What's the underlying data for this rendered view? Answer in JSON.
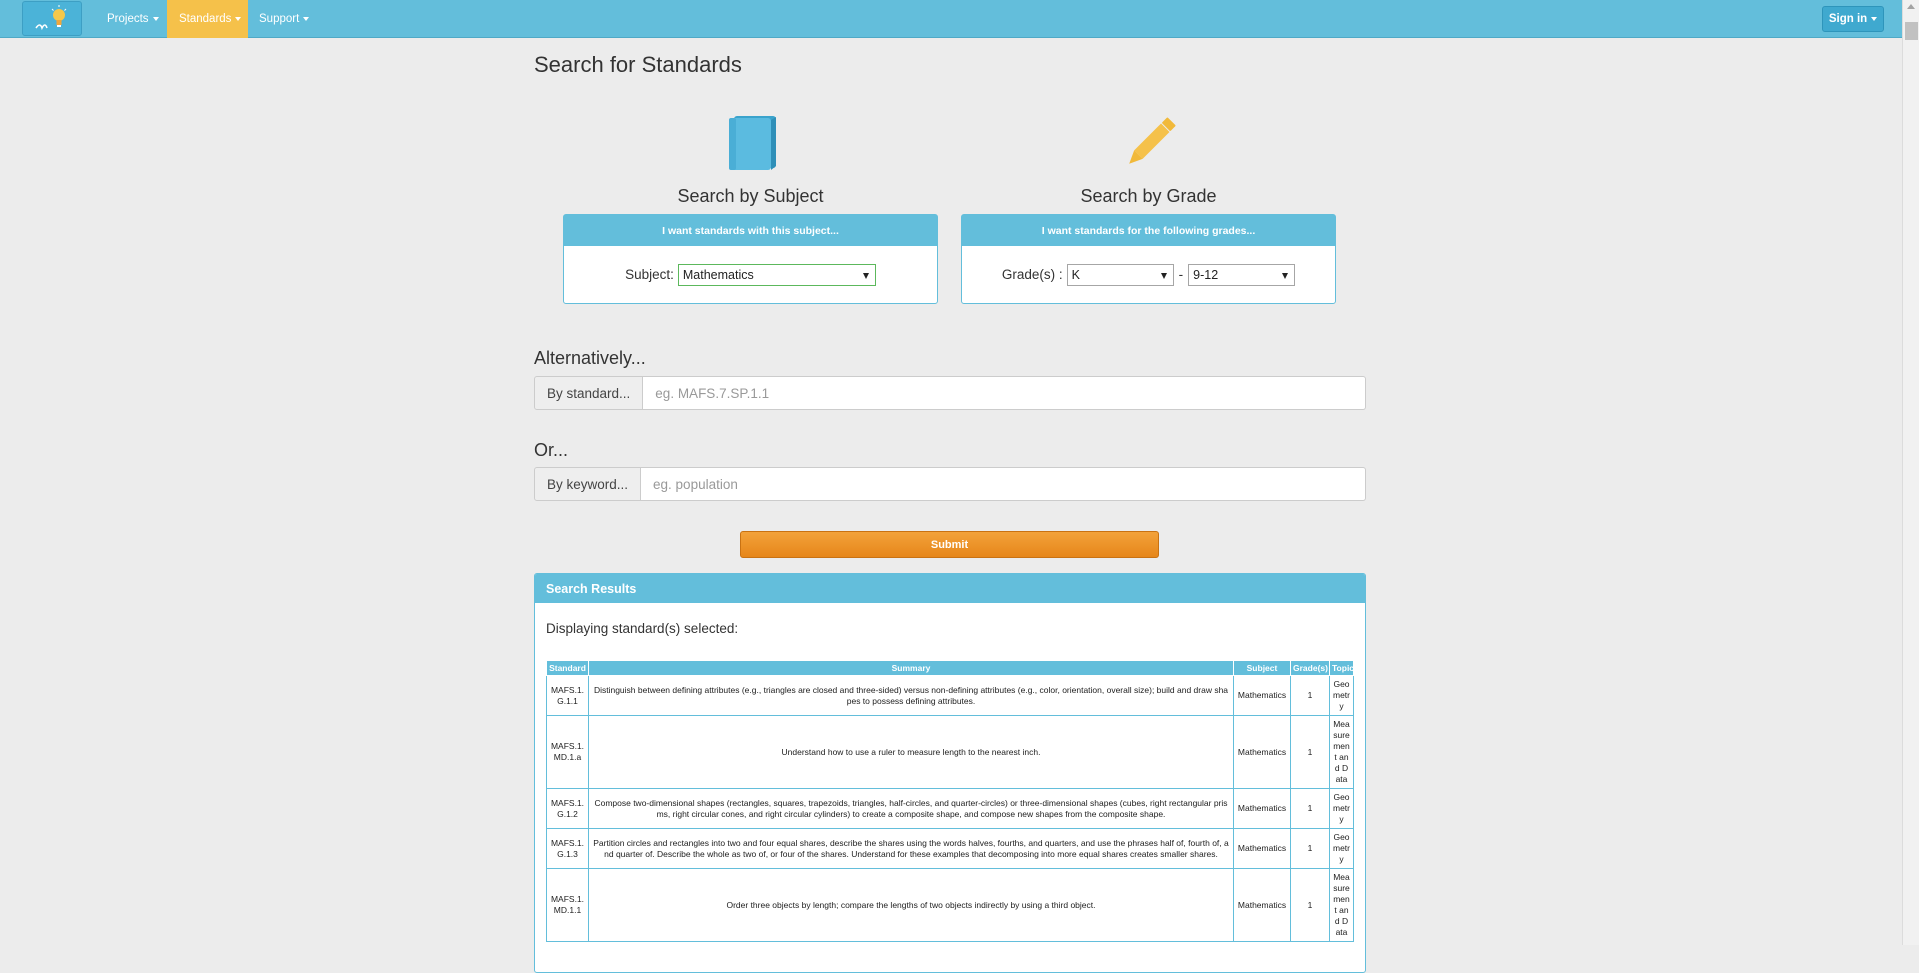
{
  "nav": {
    "items": [
      {
        "label": "Projects"
      },
      {
        "label": "Standards"
      },
      {
        "label": "Support"
      }
    ],
    "sign_in": "Sign in",
    "brand_color": "#63bedb",
    "active_color": "#f5c14a"
  },
  "page": {
    "title": "Search for Standards"
  },
  "subject_search": {
    "icon": "book-icon",
    "heading": "Search by Subject",
    "panel_title": "I want standards with this subject...",
    "field_label": "Subject:",
    "selected": "Mathematics"
  },
  "grade_search": {
    "icon": "pencil-icon",
    "heading": "Search by Grade",
    "panel_title": "I want standards for the following grades...",
    "field_label": "Grade(s) :",
    "from": "K",
    "separator": "-",
    "to": "9-12"
  },
  "standard_search": {
    "heading": "Alternatively...",
    "addon": "By standard...",
    "placeholder": "eg. MAFS.7.SP.1.1"
  },
  "keyword_search": {
    "heading": "Or...",
    "addon": "By keyword...",
    "placeholder": "eg. population"
  },
  "submit_label": "Submit",
  "results": {
    "title": "Search Results",
    "subtitle": "Displaying standard(s) selected:",
    "columns": [
      "Standard",
      "Summary",
      "Subject",
      "Grade(s)",
      "Topic"
    ],
    "rows": [
      {
        "standard": "MAFS.1.G.1.1",
        "summary": "Distinguish between defining attributes (e.g., triangles are closed and three-sided) versus non-defining attributes (e.g., color, orientation, overall size); build and draw shapes to possess defining attributes.",
        "subject": "Mathematics",
        "grade": "1",
        "topic": "Geometry"
      },
      {
        "standard": "MAFS.1.MD.1.a",
        "summary": "Understand how to use a ruler to measure length to the nearest inch.",
        "subject": "Mathematics",
        "grade": "1",
        "topic": "Measurement and Data"
      },
      {
        "standard": "MAFS.1.G.1.2",
        "summary": "Compose two-dimensional shapes (rectangles, squares, trapezoids, triangles, half-circles, and quarter-circles) or three-dimensional shapes (cubes, right rectangular prisms, right circular cones, and right circular cylinders) to create a composite shape, and compose new shapes from the composite shape.",
        "subject": "Mathematics",
        "grade": "1",
        "topic": "Geometry"
      },
      {
        "standard": "MAFS.1.G.1.3",
        "summary": "Partition circles and rectangles into two and four equal shares, describe the shares using the words halves, fourths, and quarters, and use the phrases half of, fourth of, and quarter of. Describe the whole as two of, or four of the shares. Understand for these examples that decomposing into more equal shares creates smaller shares.",
        "subject": "Mathematics",
        "grade": "1",
        "topic": "Geometry"
      },
      {
        "standard": "MAFS.1.MD.1.1",
        "summary": "Order three objects by length; compare the lengths of two objects indirectly by using a third object.",
        "subject": "Mathematics",
        "grade": "1",
        "topic": "Measurement and Data"
      }
    ]
  }
}
